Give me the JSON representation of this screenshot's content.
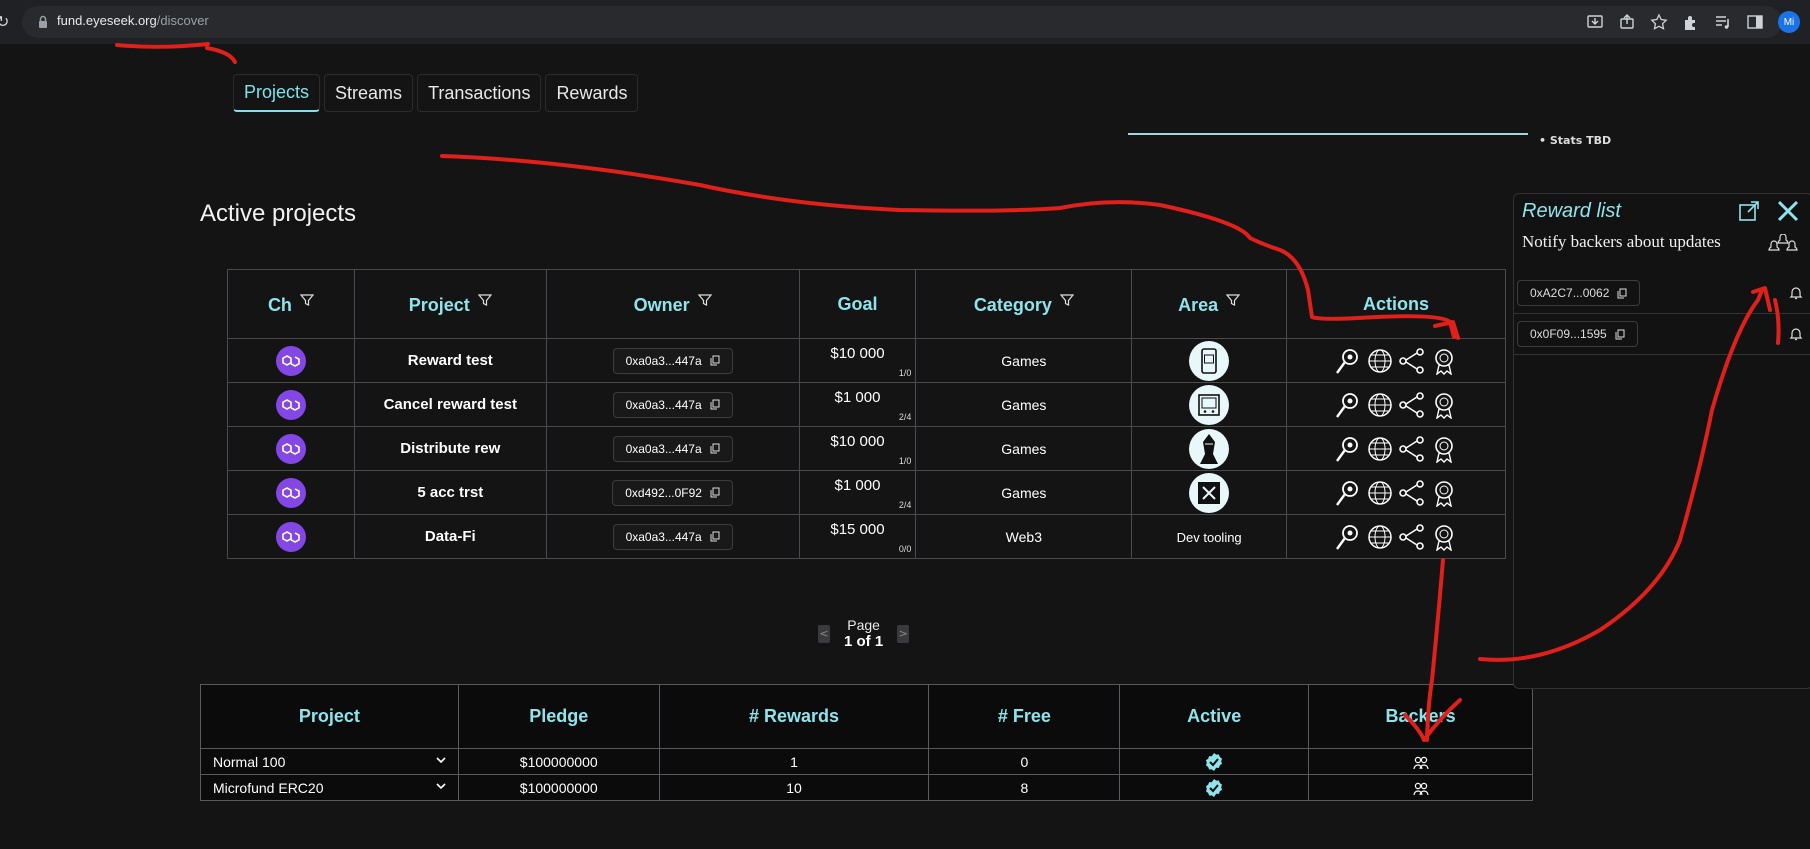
{
  "browser": {
    "url_host": "fund.eyeseek.org",
    "url_path": "/discover",
    "avatar_initials": "Mi"
  },
  "tabs": [
    {
      "label": "Projects",
      "active": true
    },
    {
      "label": "Streams",
      "active": false
    },
    {
      "label": "Transactions",
      "active": false
    },
    {
      "label": "Rewards",
      "active": false
    }
  ],
  "stats": {
    "label": "• Stats TBD"
  },
  "section_title": "Active projects",
  "projects_table": {
    "headers": {
      "ch": "Ch",
      "project": "Project",
      "owner": "Owner",
      "goal": "Goal",
      "category": "Category",
      "area": "Area",
      "actions": "Actions"
    },
    "rows": [
      {
        "project": "Reward test",
        "owner": "0xa0a3...447a",
        "goal": "$10 000",
        "goal_frac": "1/0",
        "category": "Games",
        "area_icon": "mobile-game-icon",
        "area_text": ""
      },
      {
        "project": "Cancel reward test",
        "owner": "0xa0a3...447a",
        "goal": "$1 000",
        "goal_frac": "2/4",
        "category": "Games",
        "area_icon": "console-game-icon",
        "area_text": ""
      },
      {
        "project": "Distribute rew",
        "owner": "0xa0a3...447a",
        "goal": "$10 000",
        "goal_frac": "1/0",
        "category": "Games",
        "area_icon": "character-icon",
        "area_text": ""
      },
      {
        "project": "5 acc trst",
        "owner": "0xd492...0F92",
        "goal": "$1 000",
        "goal_frac": "2/4",
        "category": "Games",
        "area_icon": "board-game-icon",
        "area_text": ""
      },
      {
        "project": "Data-Fi",
        "owner": "0xa0a3...447a",
        "goal": "$15 000",
        "goal_frac": "0/0",
        "category": "Web3",
        "area_icon": "",
        "area_text": "Dev tooling"
      }
    ]
  },
  "pagination": {
    "line1": "Page",
    "line2": "1 of 1",
    "prev": "<",
    "next": ">"
  },
  "rewards_table": {
    "headers": {
      "project": "Project",
      "pledge": "Pledge",
      "rewards": "# Rewards",
      "free": "# Free",
      "active": "Active",
      "backers": "Backers"
    },
    "rows": [
      {
        "project": "Normal 100",
        "pledge": "$100000000",
        "rewards": "1",
        "free": "0"
      },
      {
        "project": "Microfund ERC20",
        "pledge": "$100000000",
        "rewards": "10",
        "free": "8"
      }
    ]
  },
  "reward_panel": {
    "title": "Reward list",
    "subtitle": "Notify backers about updates",
    "backers": [
      "0xA2C7...0062",
      "0x0F09...1595"
    ]
  },
  "colors": {
    "accent": "#8fe4ec",
    "polygon": "#8247e5",
    "annotation": "#e0201b",
    "background": "#141415"
  }
}
